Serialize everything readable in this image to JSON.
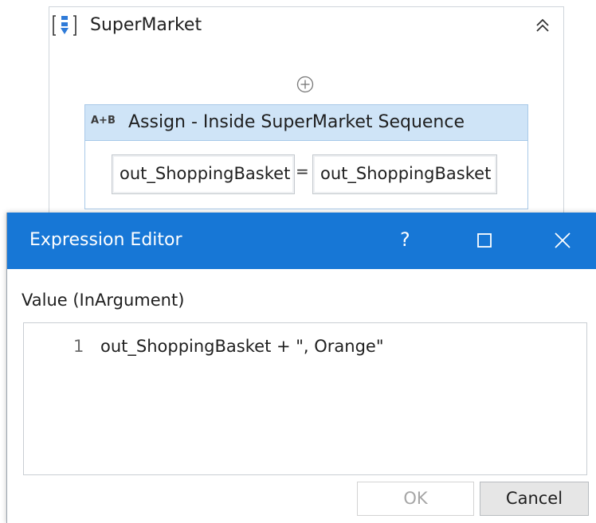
{
  "sequence": {
    "title": "SuperMarket",
    "icons": {
      "sequence": "sequence-icon",
      "collapse": "double-chevron-up-icon",
      "add": "add-circle-icon"
    }
  },
  "assign": {
    "icon_text": "A+B",
    "title": "Assign - Inside SuperMarket Sequence",
    "to_value": "out_ShoppingBasket",
    "equals": "=",
    "value_value": "out_ShoppingBasket"
  },
  "dialog": {
    "title": "Expression Editor",
    "help_label": "?",
    "titlebar_color": "#1777d6",
    "icons": {
      "maximize": "maximize-icon",
      "close": "close-icon"
    },
    "value_label": "Value (InArgument)",
    "editor": {
      "lines": [
        {
          "number": "1",
          "code": "out_ShoppingBasket + \", Orange\""
        }
      ]
    },
    "ok_label": "OK",
    "cancel_label": "Cancel"
  }
}
